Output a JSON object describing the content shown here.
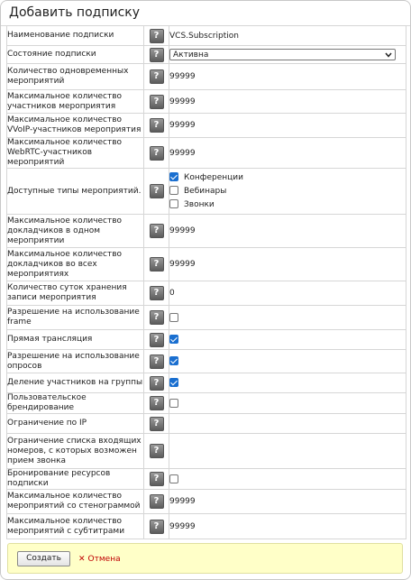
{
  "title": "Добавить подписку",
  "help_glyph": "?",
  "rows": {
    "name": {
      "label": "Наименование подписки",
      "value": "VCS.Subscription"
    },
    "state": {
      "label": "Состояние подписки",
      "value": "Активна"
    },
    "concurrent": {
      "label": "Количество одновременных мероприятий",
      "value": "99999"
    },
    "max_participants": {
      "label": "Максимальное количество участников мероприятия",
      "value": "99999"
    },
    "max_voip": {
      "label": "Максимальное количество VVoIP-участников мероприятия",
      "value": "99999"
    },
    "max_webrtc": {
      "label": "Максимальное количество WebRTC-участников мероприятий",
      "value": "99999"
    },
    "types": {
      "label": "Доступные типы мероприятий.",
      "options": [
        {
          "label": "Конференции",
          "checked": true
        },
        {
          "label": "Вебинары",
          "checked": false
        },
        {
          "label": "Звонки",
          "checked": false
        }
      ]
    },
    "speakers_one": {
      "label": "Максимальное количество докладчиков в одном мероприятии",
      "value": "99999"
    },
    "speakers_all": {
      "label": "Максимальное количество докладчиков во всех мероприятиях",
      "value": "99999"
    },
    "storage_days": {
      "label": "Количество суток хранения записи мероприятия",
      "value": "0"
    },
    "frame": {
      "label": "Разрешение на использование frame",
      "checked": false
    },
    "live": {
      "label": "Прямая трансляция",
      "checked": true
    },
    "polls": {
      "label": "Разрешение на использование опросов",
      "checked": true
    },
    "groups": {
      "label": "Деление участников на группы",
      "checked": true
    },
    "branding": {
      "label": "Пользовательское брендирование",
      "checked": false
    },
    "ip_limit": {
      "label": "Ограничение по IP",
      "value": ""
    },
    "incoming_limit": {
      "label": "Ограничение списка входящих номеров, с которых возможен прием звонка",
      "value": ""
    },
    "booking": {
      "label": "Бронирование ресурсов подписки",
      "checked": false
    },
    "stenogram": {
      "label": "Максимальное количество мероприятий со стенограммой",
      "value": "99999"
    },
    "subtitles": {
      "label": "Максимальное количество мероприятий с субтитрами",
      "value": "99999"
    }
  },
  "footer": {
    "create_label": "Создать",
    "cancel_label": "Отмена",
    "cancel_glyph": "✕"
  },
  "colors": {
    "checkbox_on": "#1a6fd0",
    "cancel": "#c00000",
    "footer_bg": "#ffffc8"
  }
}
